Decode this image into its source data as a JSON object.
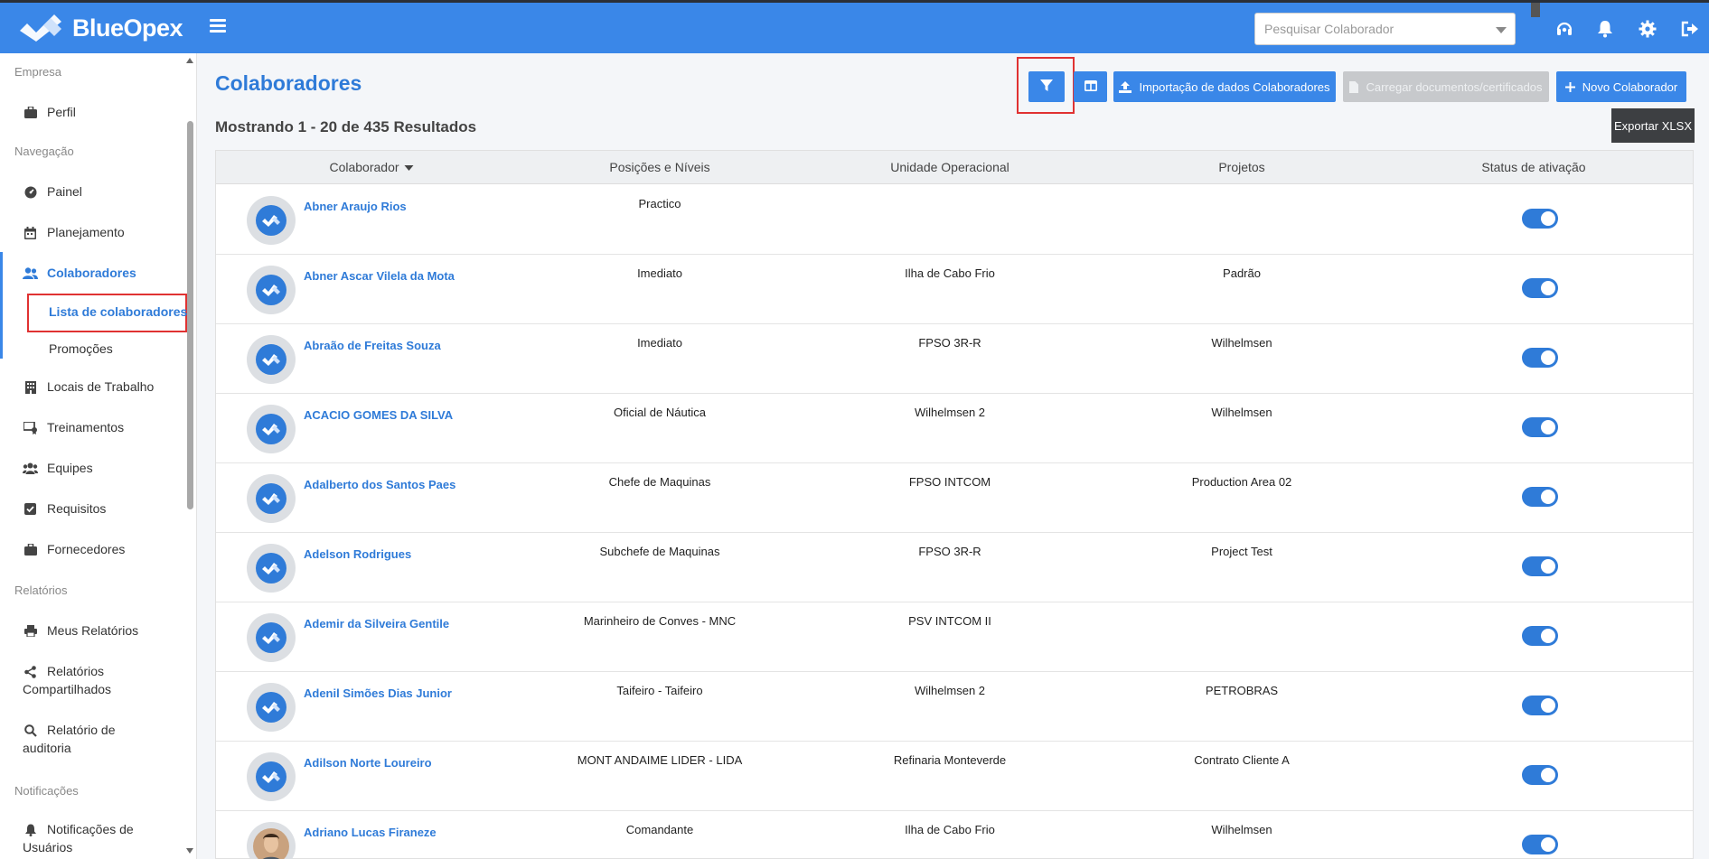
{
  "app": {
    "name": "BlueOpex"
  },
  "header": {
    "search_placeholder": "Pesquisar Colaborador",
    "icons": [
      "headset-icon",
      "bell-icon",
      "gear-icon",
      "logout-icon"
    ]
  },
  "sidebar": {
    "sections": {
      "empresa": "Empresa",
      "navegacao": "Navegação",
      "relatorios": "Relatórios",
      "notificacoes": "Notificações"
    },
    "items": {
      "perfil": "Perfil",
      "painel": "Painel",
      "planejamento": "Planejamento",
      "colaboradores": "Colaboradores",
      "lista": "Lista de colaboradores",
      "promocoes": "Promoções",
      "locais": "Locais de Trabalho",
      "treinamentos": "Treinamentos",
      "equipes": "Equipes",
      "requisitos": "Requisitos",
      "fornecedores": "Fornecedores",
      "meus_relatorios": "Meus Relatórios",
      "relatorios_compartilhados_1": "Relatórios",
      "relatorios_compartilhados_2": "Compartilhados",
      "relatorio_auditoria_1": "Relatório de",
      "relatorio_auditoria_2": "auditoria",
      "notificacoes_usuarios_1": "Notificações de",
      "notificacoes_usuarios_2": "Usuários"
    }
  },
  "main": {
    "title": "Colaboradores",
    "results": "Mostrando 1 - 20 de 435 Resultados",
    "buttons": {
      "import": "Importação de dados Colaboradores",
      "upload_docs": "Carregar documentos/certificados",
      "new": "Novo Colaborador",
      "export": "Exportar XLSX"
    },
    "columns": {
      "colaborador": "Colaborador",
      "posicoes": "Posições e Níveis",
      "unidade": "Unidade Operacional",
      "projetos": "Projetos",
      "status": "Status de ativação"
    },
    "rows": [
      {
        "name": "Abner Araujo Rios",
        "position": "Practico",
        "unit": "",
        "project": "",
        "active": true,
        "photo": false
      },
      {
        "name": "Abner Ascar Vilela da Mota",
        "position": "Imediato",
        "unit": "Ilha de Cabo Frio",
        "project": "Padrão",
        "active": true,
        "photo": false
      },
      {
        "name": "Abraão de Freitas Souza",
        "position": "Imediato",
        "unit": "FPSO 3R-R",
        "project": "Wilhelmsen",
        "active": true,
        "photo": false
      },
      {
        "name": "ACACIO GOMES DA SILVA",
        "position": "Oficial de Náutica",
        "unit": "Wilhelmsen 2",
        "project": "Wilhelmsen",
        "active": true,
        "photo": false
      },
      {
        "name": "Adalberto dos Santos Paes",
        "position": "Chefe de Maquinas",
        "unit": "FPSO INTCOM",
        "project": "Production Area 02",
        "active": true,
        "photo": false
      },
      {
        "name": "Adelson Rodrigues",
        "position": "Subchefe de Maquinas",
        "unit": "FPSO 3R-R",
        "project": "Project Test",
        "active": true,
        "photo": false
      },
      {
        "name": "Ademir da Silveira Gentile",
        "position": "Marinheiro de Conves - MNC",
        "unit": "PSV INTCOM II",
        "project": "",
        "active": true,
        "photo": false
      },
      {
        "name": "Adenil Simões Dias Junior",
        "position": "Taifeiro - Taifeiro",
        "unit": "Wilhelmsen 2",
        "project": "PETROBRAS",
        "active": true,
        "photo": false
      },
      {
        "name": "Adilson Norte Loureiro",
        "position": "MONT ANDAIME LIDER - LIDA",
        "unit": "Refinaria Monteverde",
        "project": "Contrato Cliente A",
        "active": true,
        "photo": false
      },
      {
        "name": "Adriano Lucas Firaneze",
        "position": "Comandante",
        "unit": "Ilha de Cabo Frio",
        "project": "Wilhelmsen",
        "active": true,
        "photo": true
      }
    ]
  }
}
